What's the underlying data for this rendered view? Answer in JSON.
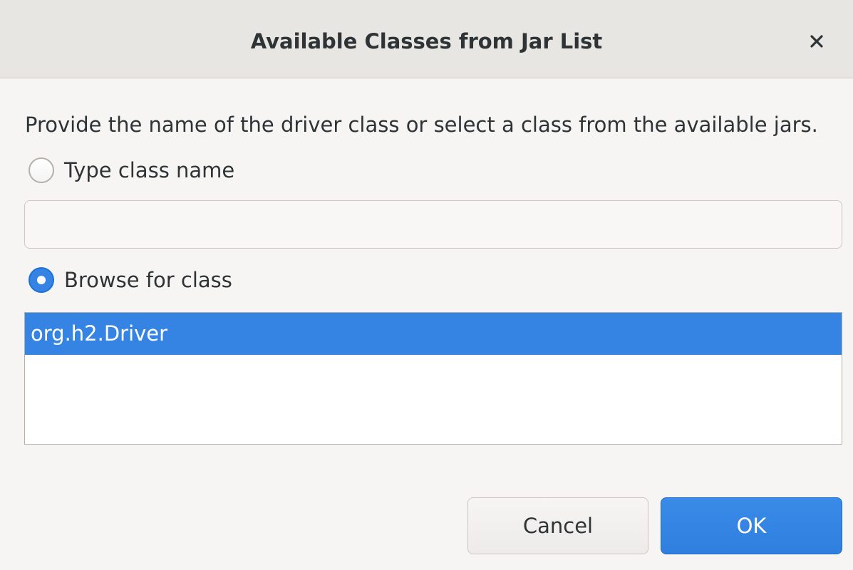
{
  "dialog": {
    "title": "Available Classes from Jar List",
    "close_icon": "close-icon"
  },
  "description": "Provide the name of the driver class or select a class from the available jars.",
  "type_option": {
    "label": "Type class name",
    "selected": false
  },
  "class_name_input": {
    "value": "",
    "placeholder": ""
  },
  "browse_option": {
    "label": "Browse for class",
    "selected": true
  },
  "class_list": {
    "items": [
      "org.h2.Driver"
    ],
    "selected_index": 0
  },
  "buttons": {
    "cancel_label": "Cancel",
    "ok_label": "OK"
  },
  "colors": {
    "accent": "#3584e4",
    "titlebar": "#e8e6e3",
    "background": "#f6f5f4"
  }
}
